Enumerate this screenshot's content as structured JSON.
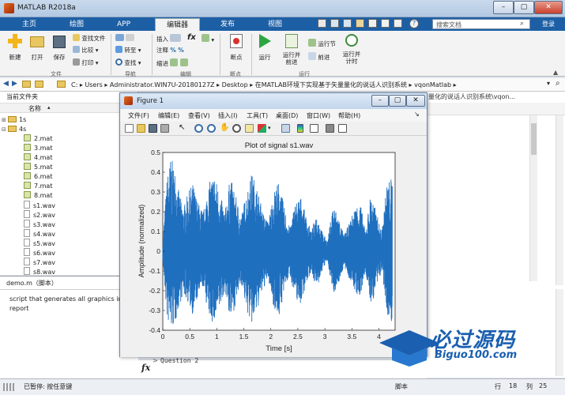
{
  "window": {
    "title": "MATLAB R2018a",
    "search_placeholder": "搜索文档",
    "login": "登录"
  },
  "tabs": [
    {
      "label": "主页"
    },
    {
      "label": "绘图"
    },
    {
      "label": "APP"
    },
    {
      "label": "编辑器"
    },
    {
      "label": "发布"
    },
    {
      "label": "视图"
    }
  ],
  "ribbon": {
    "file": {
      "new": "新建",
      "open": "打开",
      "save": "保存",
      "find_files": "查找文件",
      "compare": "比较",
      "print": "打印",
      "group": "文件"
    },
    "nav": {
      "goto": "转至",
      "find": "查找",
      "group": "导航"
    },
    "edit": {
      "insert": "插入",
      "comment": "注释",
      "indent": "缩进",
      "fx": "fx",
      "group": "编辑"
    },
    "breakpoint": {
      "label": "断点",
      "group": "断点"
    },
    "run": {
      "run": "运行",
      "run_advance": "运行并\n前进",
      "run_section": "运行节",
      "advance": "前进",
      "run_time": "运行并\n计时",
      "group": "运行"
    }
  },
  "address": {
    "path": [
      "C:",
      "Users",
      "Administrator.WIN7U-20180127Z",
      "Desktop",
      "在MATLAB环境下实现基于矢量量化的说话人识别系统",
      "vqonMatlab"
    ]
  },
  "file_panel": {
    "title": "当前文件夹",
    "column": "名称",
    "items": [
      {
        "name": "1s",
        "type": "folder"
      },
      {
        "name": "4s",
        "type": "folder"
      },
      {
        "name": "2.mat",
        "type": "mat"
      },
      {
        "name": "3.mat",
        "type": "mat"
      },
      {
        "name": "4.mat",
        "type": "mat"
      },
      {
        "name": "5.mat",
        "type": "mat"
      },
      {
        "name": "6.mat",
        "type": "mat"
      },
      {
        "name": "7.mat",
        "type": "mat"
      },
      {
        "name": "8.mat",
        "type": "mat"
      },
      {
        "name": "s1.wav",
        "type": "wav"
      },
      {
        "name": "s2.wav",
        "type": "wav"
      },
      {
        "name": "s3.wav",
        "type": "wav"
      },
      {
        "name": "s4.wav",
        "type": "wav"
      },
      {
        "name": "s5.wav",
        "type": "wav"
      },
      {
        "name": "s6.wav",
        "type": "wav"
      },
      {
        "name": "s7.wav",
        "type": "wav"
      },
      {
        "name": "s8.wav",
        "type": "wav"
      }
    ]
  },
  "detail": {
    "title": "demo.m（脚本）",
    "text1": "script that generates all graphics in",
    "text2": "report"
  },
  "right_panel": {
    "path": "量化的说话人识别系统\\vqon..."
  },
  "command": {
    "fx": "fx",
    "line": "Question 2"
  },
  "status": {
    "left": "已暂停: 按任意键",
    "script": "脚本",
    "row_label": "行",
    "row": "18",
    "col_label": "列",
    "col": "25"
  },
  "figure": {
    "title": "Figure 1",
    "menu": [
      "文件(F)",
      "编辑(E)",
      "查看(V)",
      "插入(I)",
      "工具(T)",
      "桌面(D)",
      "窗口(W)",
      "帮助(H)"
    ]
  },
  "chart_data": {
    "type": "line",
    "title": "Plot of signal s1.wav",
    "xlabel": "Time [s]",
    "ylabel": "Amplitude (normalized)",
    "xlim": [
      0,
      4.3
    ],
    "ylim": [
      -0.4,
      0.5
    ],
    "xticks": [
      "0",
      "0.5",
      "1",
      "1.5",
      "2",
      "2.5",
      "3",
      "3.5",
      "4"
    ],
    "yticks": [
      "-0.4",
      "-0.3",
      "-0.2",
      "-0.1",
      "0",
      "0.1",
      "0.2",
      "0.3",
      "0.4",
      "0.5"
    ],
    "color": "#1f6fbf",
    "envelope": {
      "x": [
        0,
        0.08,
        0.15,
        0.22,
        0.3,
        0.38,
        0.45,
        0.55,
        0.65,
        0.75,
        0.85,
        0.95,
        1.05,
        1.15,
        1.25,
        1.35,
        1.45,
        1.55,
        1.65,
        1.75,
        1.85,
        1.95,
        2.05,
        2.15,
        2.25,
        2.35,
        2.45,
        2.55,
        2.65,
        2.75,
        2.85,
        2.95,
        3.05,
        3.15,
        3.25,
        3.35,
        3.45,
        3.55,
        3.65,
        3.75,
        3.85,
        3.95,
        4.05,
        4.15,
        4.25
      ],
      "upper": [
        0.05,
        0.38,
        0.48,
        0.42,
        0.3,
        0.22,
        0.28,
        0.35,
        0.25,
        0.2,
        0.34,
        0.4,
        0.3,
        0.2,
        0.38,
        0.28,
        0.18,
        0.3,
        0.4,
        0.32,
        0.2,
        0.15,
        0.3,
        0.36,
        0.22,
        0.12,
        0.25,
        0.28,
        0.18,
        0.1,
        0.2,
        0.1,
        0.05,
        0.24,
        0.18,
        0.08,
        0.14,
        0.22,
        0.26,
        0.1,
        0.3,
        0.2,
        0.1,
        0.35,
        0.38
      ],
      "lower": [
        -0.05,
        -0.35,
        -0.4,
        -0.38,
        -0.28,
        -0.22,
        -0.25,
        -0.32,
        -0.24,
        -0.18,
        -0.33,
        -0.38,
        -0.3,
        -0.2,
        -0.36,
        -0.27,
        -0.16,
        -0.3,
        -0.38,
        -0.3,
        -0.2,
        -0.14,
        -0.28,
        -0.34,
        -0.2,
        -0.12,
        -0.24,
        -0.27,
        -0.17,
        -0.1,
        -0.2,
        -0.1,
        -0.05,
        -0.22,
        -0.17,
        -0.08,
        -0.14,
        -0.2,
        -0.25,
        -0.1,
        -0.28,
        -0.2,
        -0.1,
        -0.33,
        -0.36
      ]
    }
  },
  "logo": {
    "text": "必过源码",
    "sub": "Biguo100.com"
  },
  "colors": {
    "accent": "#1d5fa5",
    "signal": "#1f6fbf"
  }
}
